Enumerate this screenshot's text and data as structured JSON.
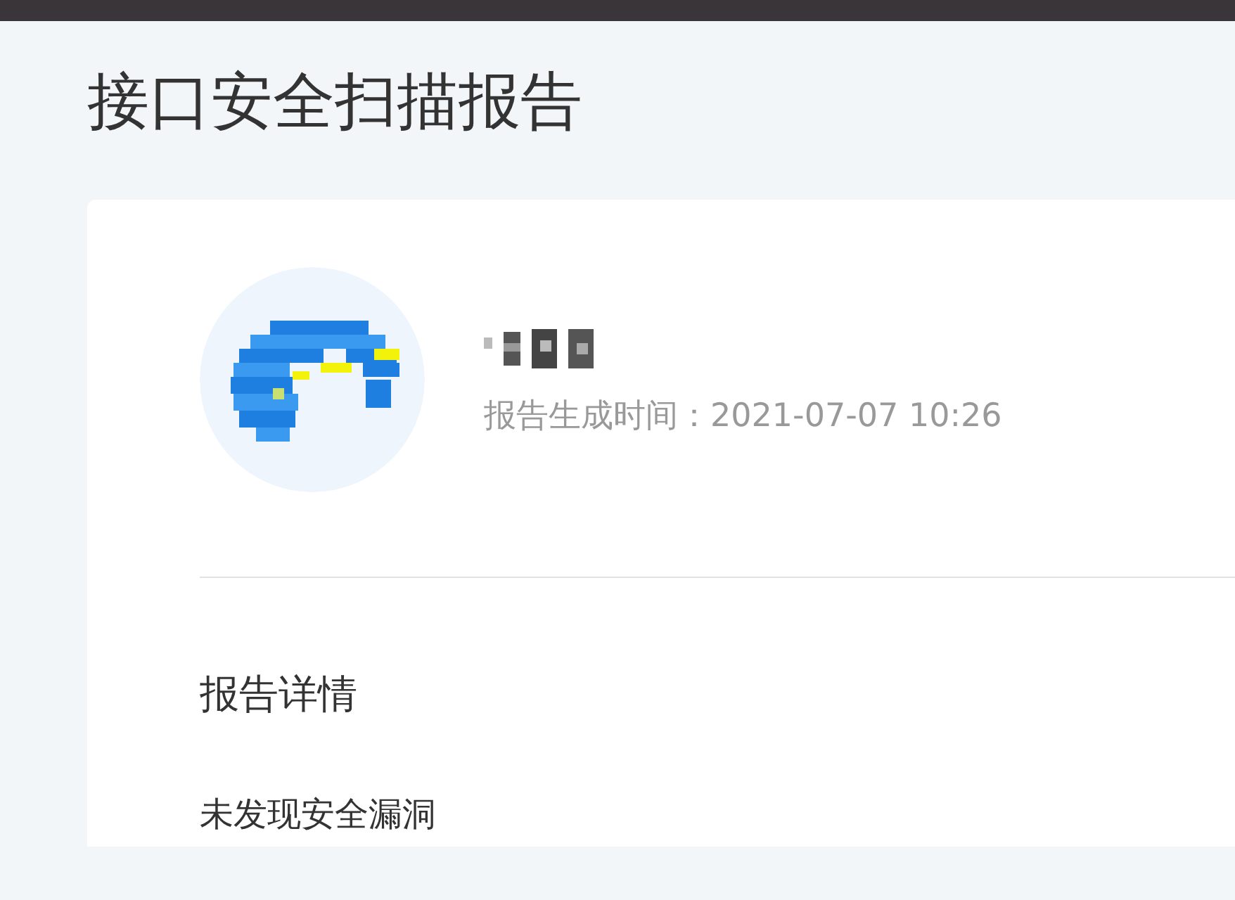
{
  "page": {
    "title": "接口安全扫描报告"
  },
  "report": {
    "generated": "报告生成时间：2021-07-07 10:26",
    "section_title": "报告详情",
    "result": "未发现安全漏洞"
  }
}
